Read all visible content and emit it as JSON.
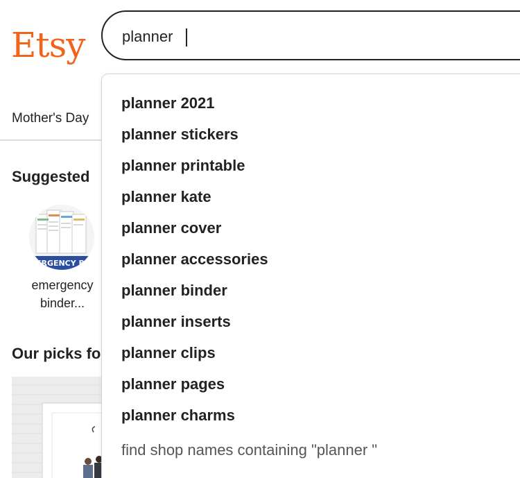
{
  "colors": {
    "brand": "#F1641E",
    "text": "#222222",
    "muted": "#555555",
    "border": "#d4d4d4"
  },
  "header": {
    "logo_text": "Etsy",
    "search": {
      "value": "planner",
      "placeholder": "Search for anything"
    }
  },
  "nav": {
    "items": [
      {
        "label": "Mother's Day"
      }
    ]
  },
  "suggested": {
    "title": "Suggested",
    "items": [
      {
        "caption_line1": "emergency",
        "caption_line2": "binder...",
        "image_text": "ERGENCY BI"
      }
    ]
  },
  "picks": {
    "title": "Our picks fo"
  },
  "autocomplete": {
    "suggestions": [
      "planner 2021",
      "planner stickers",
      "planner printable",
      "planner kate",
      "planner cover",
      "planner accessories",
      "planner binder",
      "planner inserts",
      "planner clips",
      "planner pages",
      "planner charms"
    ],
    "shop_search": "find shop names containing \"planner \""
  }
}
